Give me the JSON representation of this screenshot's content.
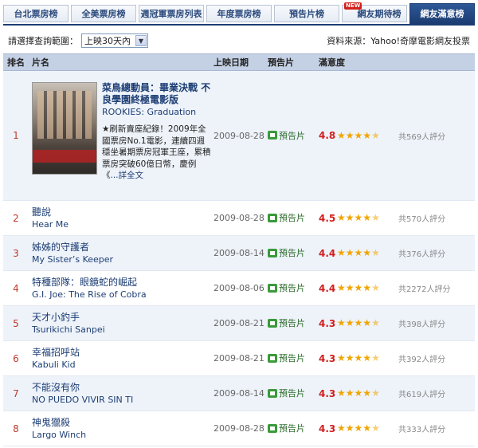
{
  "tabs": [
    {
      "label": "台北票房榜",
      "active": false,
      "badge": ""
    },
    {
      "label": "全美票房榜",
      "active": false,
      "badge": ""
    },
    {
      "label": "週冠軍票房列表",
      "active": false,
      "badge": ""
    },
    {
      "label": "年度票房榜",
      "active": false,
      "badge": ""
    },
    {
      "label": "預告片榜",
      "active": false,
      "badge": ""
    },
    {
      "label": "網友期待榜",
      "active": false,
      "badge": "NEW"
    },
    {
      "label": "網友滿意榜",
      "active": true,
      "badge": ""
    }
  ],
  "filter": {
    "label": "請選擇查詢範圍：",
    "selected": "上映30天內",
    "source": "資料來源：Yahoo!奇摩電影網友投票"
  },
  "table": {
    "headers": {
      "rank": "排名",
      "title": "片名",
      "date": "上映日期",
      "trailer": "預告片",
      "rating": "滿意度"
    },
    "trailer_label": "預告片",
    "featured": {
      "rank": "1",
      "title_zh": "菜鳥總動員：畢業決戰 不良學園終極電影版",
      "title_en": "ROOKIES: Graduation",
      "description": "★刷新賣座紀錄！2009年全國票房No.1電影，連續四週穩坐暑期票房冠軍王座，累積票房突破60億日幣，慶例《",
      "more": "...詳全文",
      "date": "2009-08-28",
      "score": "4.8",
      "stars": 4.8,
      "votes": "共569人評分"
    },
    "rows": [
      {
        "rank": "2",
        "title_zh": "聽說",
        "title_en": "Hear Me",
        "date": "2009-08-28",
        "score": "4.5",
        "stars": 4.5,
        "votes": "共570人評分"
      },
      {
        "rank": "3",
        "title_zh": "姊姊的守護者",
        "title_en": "My Sister’s Keeper",
        "date": "2009-08-14",
        "score": "4.4",
        "stars": 4.4,
        "votes": "共376人評分"
      },
      {
        "rank": "4",
        "title_zh": "特種部隊：眼鏡蛇的崛起",
        "title_en": "G.I. Joe: The Rise of Cobra",
        "date": "2009-08-06",
        "score": "4.4",
        "stars": 4.4,
        "votes": "共2272人評分"
      },
      {
        "rank": "5",
        "title_zh": "天才小釣手",
        "title_en": "Tsurikichi Sanpei",
        "date": "2009-08-21",
        "score": "4.3",
        "stars": 4.3,
        "votes": "共398人評分"
      },
      {
        "rank": "6",
        "title_zh": "幸福招呼站",
        "title_en": "Kabuli Kid",
        "date": "2009-08-21",
        "score": "4.3",
        "stars": 4.3,
        "votes": "共392人評分"
      },
      {
        "rank": "7",
        "title_zh": "不能沒有你",
        "title_en": "NO PUEDO VIVIR SIN TI",
        "date": "2009-08-14",
        "score": "4.3",
        "stars": 4.3,
        "votes": "共619人評分"
      },
      {
        "rank": "8",
        "title_zh": "神鬼獵殺",
        "title_en": "Largo Winch",
        "date": "2009-08-28",
        "score": "4.3",
        "stars": 4.3,
        "votes": "共333人評分"
      }
    ]
  },
  "icons": {
    "trailer": "film-icon",
    "star": "star-icon",
    "dropdown": "chevron-down-icon"
  },
  "colors": {
    "tab_active": "#1c3d73",
    "rank": "#c0392b",
    "score": "#d21f1f",
    "star": "#f0a500",
    "header_bg": "#c4d0e4"
  }
}
